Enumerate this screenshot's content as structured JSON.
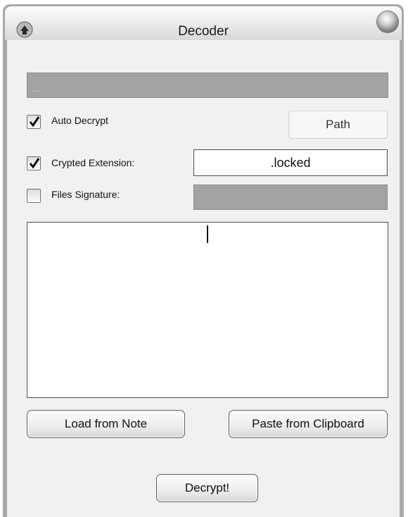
{
  "window": {
    "title": "Decoder"
  },
  "path_display": {
    "value": "..."
  },
  "options": {
    "auto_decrypt": {
      "label": "Auto Decrypt",
      "checked": true
    },
    "crypted_extension": {
      "label": "Crypted Extension:",
      "checked": true,
      "value": ".locked"
    },
    "files_signature": {
      "label": "Files Signature:",
      "checked": false,
      "value": ""
    }
  },
  "buttons": {
    "path": "Path",
    "load_from_note": "Load from Note",
    "paste_from_clipboard": "Paste from Clipboard",
    "decrypt": "Decrypt!"
  },
  "note": {
    "value": ""
  }
}
